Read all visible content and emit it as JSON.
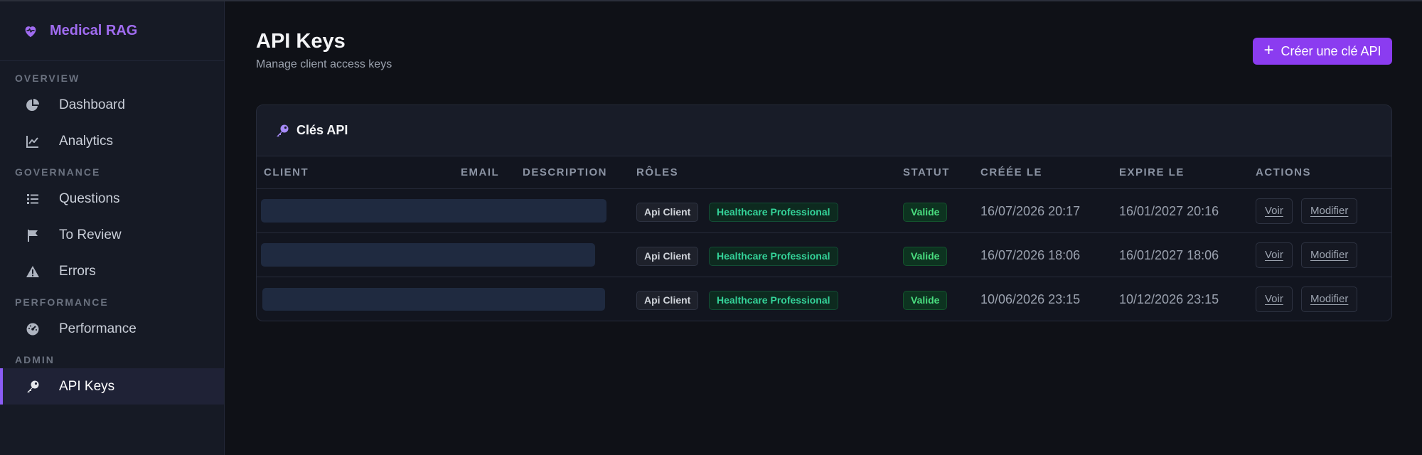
{
  "brand": {
    "name": "Medical RAG",
    "icon": "heart-pulse-icon",
    "accent": "#a06cf0"
  },
  "sidebar": {
    "sections": [
      {
        "title": "OVERVIEW",
        "items": [
          {
            "label": "Dashboard",
            "icon": "pie-chart-icon"
          },
          {
            "label": "Analytics",
            "icon": "line-chart-icon"
          }
        ]
      },
      {
        "title": "GOVERNANCE",
        "items": [
          {
            "label": "Questions",
            "icon": "list-icon"
          },
          {
            "label": "To Review",
            "icon": "flag-icon"
          },
          {
            "label": "Errors",
            "icon": "warning-icon"
          }
        ]
      },
      {
        "title": "PERFORMANCE",
        "items": [
          {
            "label": "Performance",
            "icon": "gauge-icon"
          }
        ]
      },
      {
        "title": "ADMIN",
        "items": [
          {
            "label": "API Keys",
            "icon": "key-icon",
            "active": true
          }
        ]
      }
    ]
  },
  "header": {
    "title": "API Keys",
    "subtitle": "Manage client access keys",
    "create_label": "Créer une clé API"
  },
  "card": {
    "title": "Clés API",
    "columns": [
      "CLIENT",
      "EMAIL",
      "DESCRIPTION",
      "RÔLES",
      "STATUT",
      "CRÉÉE LE",
      "EXPIRE LE",
      "ACTIONS"
    ],
    "rows": [
      {
        "roles": [
          "Api Client",
          "Healthcare Professional"
        ],
        "status": "Valide",
        "created": "16/07/2026 20:17",
        "expires": "16/01/2027 20:16",
        "view_label": "Voir",
        "edit_label": "Modifier"
      },
      {
        "roles": [
          "Api Client",
          "Healthcare Professional"
        ],
        "status": "Valide",
        "created": "16/07/2026 18:06",
        "expires": "16/01/2027 18:06",
        "view_label": "Voir",
        "edit_label": "Modifier"
      },
      {
        "roles": [
          "Api Client",
          "Healthcare Professional"
        ],
        "status": "Valide",
        "created": "10/06/2026 23:15",
        "expires": "10/12/2026 23:15",
        "view_label": "Voir",
        "edit_label": "Modifier"
      }
    ]
  },
  "colors": {
    "primary_button": "#8b3cf0",
    "status_valid": "#4ade80",
    "role_professional": "#34d399"
  }
}
